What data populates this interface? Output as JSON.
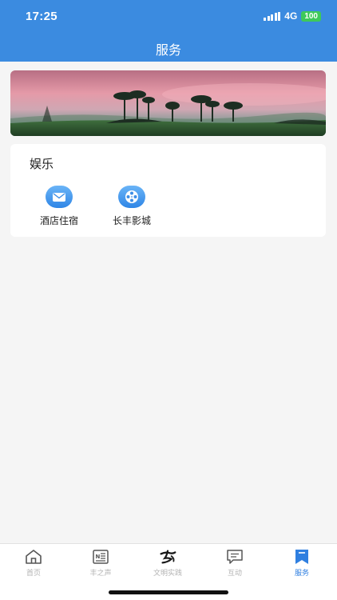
{
  "status_bar": {
    "time": "17:25",
    "network": "4G",
    "battery": "100"
  },
  "header": {
    "title": "服务"
  },
  "banner": {
    "image": "landscape-banner"
  },
  "section": {
    "title": "娱乐",
    "items": [
      {
        "label": "酒店住宿",
        "icon": "envelope-icon"
      },
      {
        "label": "长丰影城",
        "icon": "film-reel-icon"
      }
    ]
  },
  "tabbar": {
    "items": [
      {
        "label": "首页",
        "icon": "home-icon",
        "active": false
      },
      {
        "label": "丰之声",
        "icon": "news-icon",
        "active": false
      },
      {
        "label": "文明实践",
        "icon": "calligraphy-logo-icon",
        "active": false
      },
      {
        "label": "互动",
        "icon": "chat-icon",
        "active": false
      },
      {
        "label": "服务",
        "icon": "bookmark-icon",
        "active": true
      }
    ]
  },
  "colors": {
    "primary": "#3b8be0",
    "active_tab": "#2f7fe0",
    "inactive_tab": "#b3b3b3",
    "background": "#f5f5f5"
  }
}
